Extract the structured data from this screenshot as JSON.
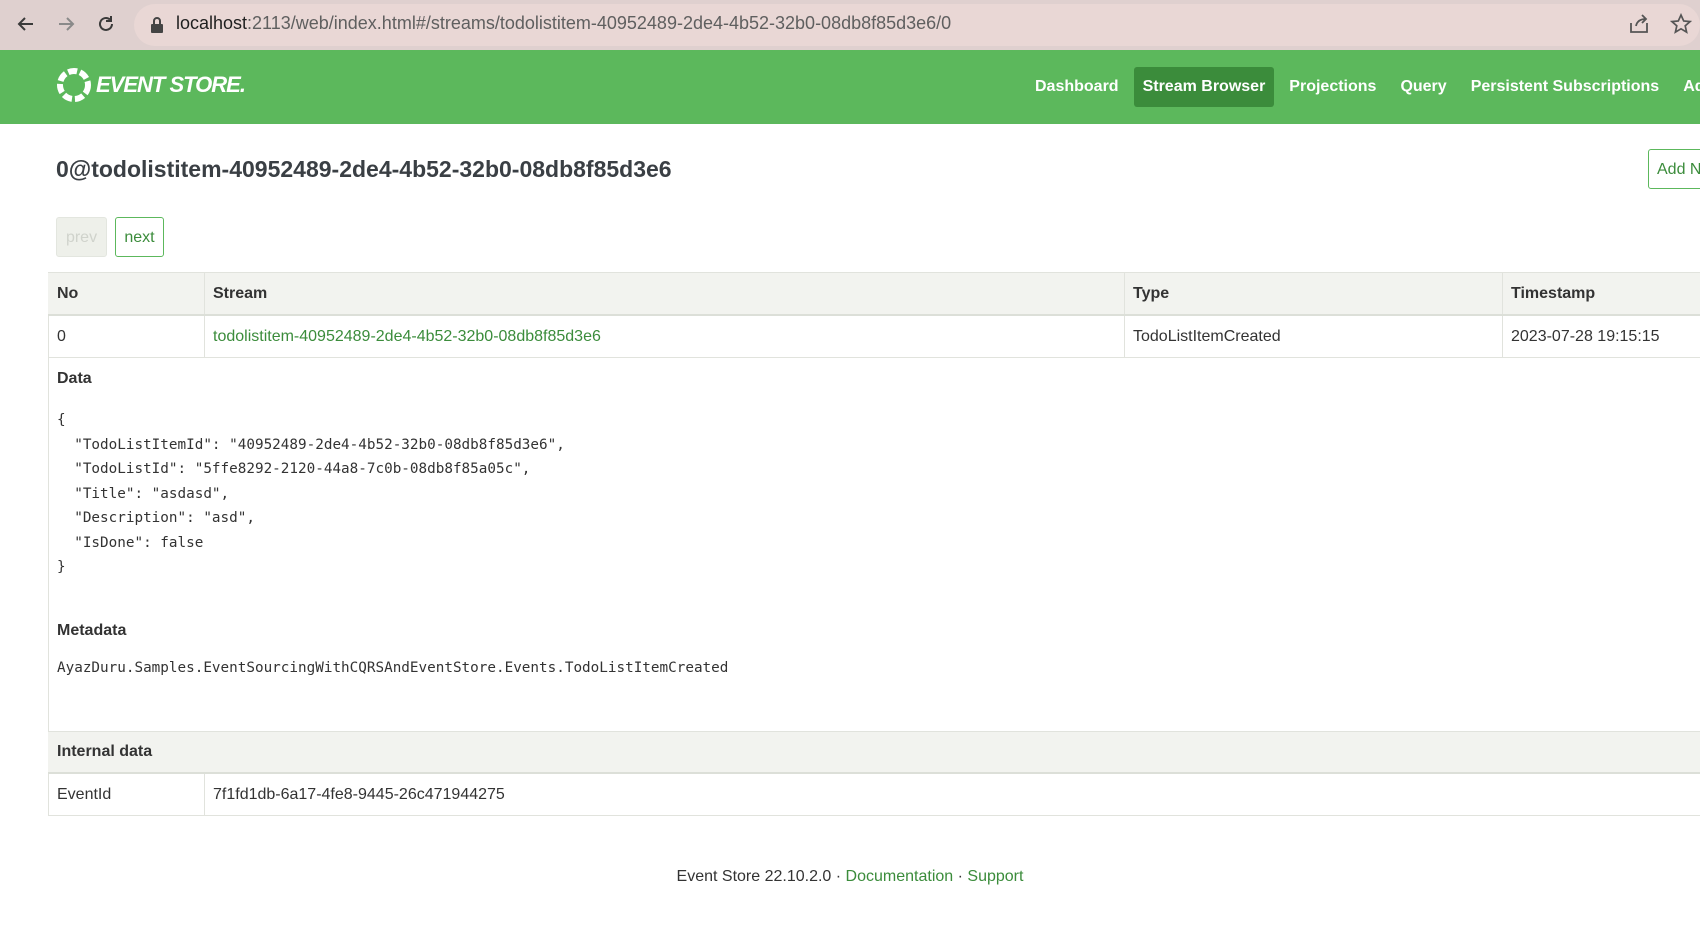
{
  "browser": {
    "url_host": "localhost",
    "url_path": ":2113/web/index.html#/streams/todolistitem-40952489-2de4-4b52-32b0-08db8f85d3e6/0"
  },
  "app": {
    "logo_text": "EVENT STORE.",
    "menu": [
      {
        "label": "Dashboard",
        "active": false
      },
      {
        "label": "Stream Browser",
        "active": true
      },
      {
        "label": "Projections",
        "active": false
      },
      {
        "label": "Query",
        "active": false
      },
      {
        "label": "Persistent Subscriptions",
        "active": false
      },
      {
        "label": "Admi",
        "active": false
      }
    ],
    "brand_color": "#5cb85c"
  },
  "page": {
    "title": "0@todolistitem-40952489-2de4-4b52-32b0-08db8f85d3e6",
    "add_button": "Add N",
    "prev": "prev",
    "next": "next"
  },
  "table": {
    "headers": [
      "No",
      "Stream",
      "Type",
      "Timestamp"
    ],
    "row": {
      "no": "0",
      "stream": "todolistitem-40952489-2de4-4b52-32b0-08db8f85d3e6",
      "type": "TodoListItemCreated",
      "timestamp": "2023-07-28 19:15:15"
    }
  },
  "data_section": {
    "label": "Data",
    "json": "{\n  \"TodoListItemId\": \"40952489-2de4-4b52-32b0-08db8f85d3e6\",\n  \"TodoListId\": \"5ffe8292-2120-44a8-7c0b-08db8f85a05c\",\n  \"Title\": \"asdasd\",\n  \"Description\": \"asd\",\n  \"IsDone\": false\n}"
  },
  "metadata_section": {
    "label": "Metadata",
    "value": "AyazDuru.Samples.EventSourcingWithCQRSAndEventStore.Events.TodoListItemCreated"
  },
  "internal": {
    "label": "Internal data",
    "key": "EventId",
    "value": "7f1fd1db-6a17-4fe8-9445-26c471944275"
  },
  "footer": {
    "version": "Event Store 22.10.2.0 · ",
    "documentation": "Documentation",
    "sep": " · ",
    "support": "Support"
  }
}
